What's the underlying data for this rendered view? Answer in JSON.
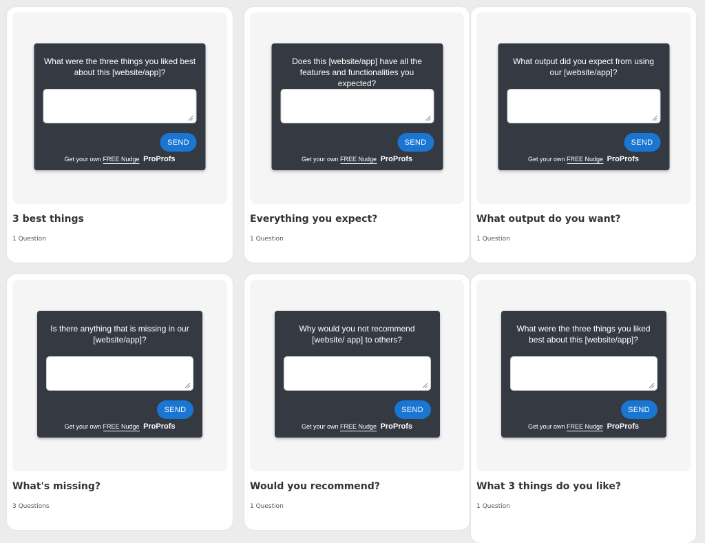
{
  "widget_common": {
    "send_label": "SEND",
    "footer_prefix": "Get your own",
    "footer_link": "FREE Nudge",
    "brand": "ProProfs"
  },
  "cards": [
    {
      "question": "What were the three things you liked best about this [website/app]?",
      "title": "3 best things",
      "count": "1 Question"
    },
    {
      "question": "Does this [website/app] have all the features and functionalities you expected?",
      "title": "Everything you expect?",
      "count": "1 Question"
    },
    {
      "question": "What output did you expect from using our [website/app]?",
      "title": "What output do you want?",
      "count": "1 Question"
    },
    {
      "question": "Is there anything that is missing in our [website/app]?",
      "title": "What's missing?",
      "count": "3 Questions"
    },
    {
      "question": "Why would you not recommend [website/ app] to others?",
      "title": "Would you recommend?",
      "count": "1 Question"
    },
    {
      "question": "What were the three things you liked best about this [website/app]?",
      "title": "What 3 things do you like?",
      "count": "1 Question"
    }
  ]
}
